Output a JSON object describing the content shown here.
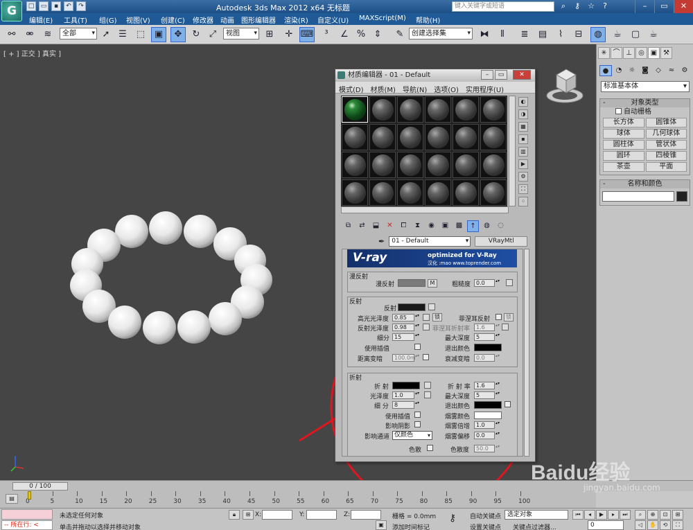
{
  "titlebar": {
    "app_title": "Autodesk 3ds Max  2012 x64      无标题",
    "search_placeholder": "键入关键字或短语"
  },
  "menubar": [
    "编辑(E)",
    "工具(T)",
    "组(G)",
    "视图(V)",
    "创建(C)",
    "修改器",
    "动画",
    "图形编辑器",
    "渲染(R)",
    "自定义(U)",
    "MAXScript(M)",
    "帮助(H)"
  ],
  "toolbar": {
    "selection_filter": "全部",
    "ref_coord": "视图",
    "named_selection": "创建选择集"
  },
  "viewport": {
    "label": "[ + ] 正交 ] 真实 ]",
    "object": "pearl-bracelet",
    "bead_count": 15
  },
  "command_panel": {
    "category": "标准基本体",
    "object_type_title": "对象类型",
    "autogrid": "自动栅格",
    "object_buttons": [
      "长方体",
      "圆锥体",
      "球体",
      "几何球体",
      "圆柱体",
      "管状体",
      "圆环",
      "四棱锥",
      "茶壶",
      "平面"
    ],
    "name_color_title": "名称和颜色"
  },
  "material_editor": {
    "title": "材质编辑器 - 01 - Default",
    "menu": [
      "模式(D)",
      "材质(M)",
      "导航(N)",
      "选项(O)",
      "实用程序(U)"
    ],
    "material_name": "01 - Default",
    "material_type": "VRayMtl",
    "banner": {
      "logo": "V-ray",
      "line1": "optimized for V-Ray",
      "line2": "汉化 :mao www.toprender.com"
    },
    "diffuse": {
      "title": "漫反射",
      "diffuse_label": "漫反射",
      "diffuse_map_button": "M",
      "roughness_label": "粗糙度",
      "roughness_value": "0.0",
      "diffuse_color": "#7a7a7a"
    },
    "reflection": {
      "title": "反射",
      "reflect_label": "反射",
      "hilight_gloss_label": "高光光泽度",
      "hilight_gloss_value": "0.85",
      "lock_label": "锁",
      "fresnel_label": "菲涅耳反射",
      "refl_gloss_label": "反射光泽度",
      "refl_gloss_value": "0.98",
      "fresnel_ior_label": "菲涅耳折射率",
      "fresnel_ior_value": "1.6",
      "subdivs_label": "细分",
      "subdivs_value": "15",
      "max_depth_label": "最大深度",
      "max_depth_value": "5",
      "use_interp_label": "使用插值",
      "exit_color_label": "退出颜色",
      "dim_distance_label": "距离变暗",
      "dim_distance_value": "100.0m",
      "dim_falloff_label": "衰减变暗",
      "dim_falloff_value": "0.0",
      "reflect_color": "#1a1a1a",
      "exit_color": "#000000"
    },
    "refraction": {
      "title": "折射",
      "refract_label": "折 射",
      "ior_label": "折 射 率",
      "ior_value": "1.6",
      "gloss_label": "光泽度",
      "gloss_value": "1.0",
      "max_depth_label": "最大深度",
      "max_depth_value": "5",
      "subdivs_label": "细 分",
      "subdivs_value": "8",
      "exit_color_label": "退出颜色",
      "use_interp_label": "使用插值",
      "fog_color_label": "烟雾颜色",
      "affect_shadows_label": "影响阴影",
      "fog_multiplier_label": "烟雾倍增",
      "fog_multiplier_value": "1.0",
      "affect_channels_label": "影响通道",
      "affect_channels_value": "仅颜色",
      "fog_bias_label": "烟雾偏移",
      "fog_bias_value": "0.0",
      "dispersion_label": "色散",
      "abbe_label": "色散度",
      "abbe_value": "50.0",
      "refract_color": "#000000",
      "fog_color": "#ffffff"
    }
  },
  "timeline": {
    "slider": "0 / 100",
    "ticks": [
      "0",
      "5",
      "10",
      "15",
      "20",
      "25",
      "30",
      "35",
      "40",
      "45",
      "50",
      "55",
      "60",
      "65",
      "70",
      "75",
      "80",
      "85",
      "90",
      "95",
      "100"
    ]
  },
  "status": {
    "maxscript": "-- 所在行: <",
    "selection": "未选定任何对象",
    "prompt": "单击并拖动以选择并移动对象",
    "x_label": "X:",
    "y_label": "Y:",
    "z_label": "Z:",
    "grid": "栅格 = 0.0mm",
    "add_time_tag": "添加时间标记",
    "auto_key": "自动关键点",
    "selected_object": "选定对象",
    "set_key": "设置关键点",
    "key_filters": "关键点过滤器...",
    "frame": "0"
  },
  "watermark": {
    "brand": "Baidu经验",
    "url": "jingyan.baidu.com"
  }
}
